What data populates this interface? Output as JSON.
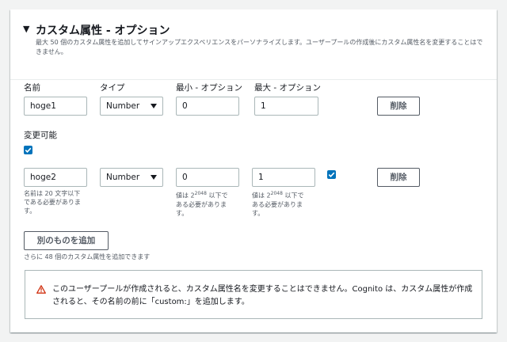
{
  "section": {
    "toggle_glyph": "▼",
    "title": "カスタム属性 - オプション",
    "description": "最大 50 個のカスタム属性を追加してサインアップエクスペリエンスをパーソナライズします。ユーザープールの作成後にカスタム属性名を変更することはできません。"
  },
  "columns": {
    "name": "名前",
    "type": "タイプ",
    "min": "最小 - オプション",
    "max": "最大 - オプション"
  },
  "attributes": [
    {
      "name": "hoge1",
      "type": "Number",
      "min": "0",
      "max": "1",
      "mutable": true,
      "remove_label": "削除"
    },
    {
      "name": "hoge2",
      "type": "Number",
      "min": "0",
      "max": "1",
      "mutable": true,
      "remove_label": "削除"
    }
  ],
  "mutable_label": "変更可能",
  "hints": {
    "name_prefix": "名前は 20 文字以下",
    "name_rest": "である必要がありま す。",
    "value_prefix": "値は 2",
    "value_exp": "2048",
    "value_suffix": " 以下で",
    "value_rest": "ある必要がありま す。"
  },
  "add_button": "別のものを追加",
  "remaining_text": "さらに 48 個のカスタム属性を追加できます",
  "alert": {
    "icon": "warning-icon",
    "text": "このユーザープールが作成されると、カスタム属性名を変更することはできません。Cognito は、カスタム属性が作成されると、その名前の前に「custom:」を追加します。"
  },
  "colors": {
    "accent_checkbox": "#0073bb",
    "warning": "#d13212",
    "border": "#aab7b8",
    "muted_text": "#545b64"
  }
}
